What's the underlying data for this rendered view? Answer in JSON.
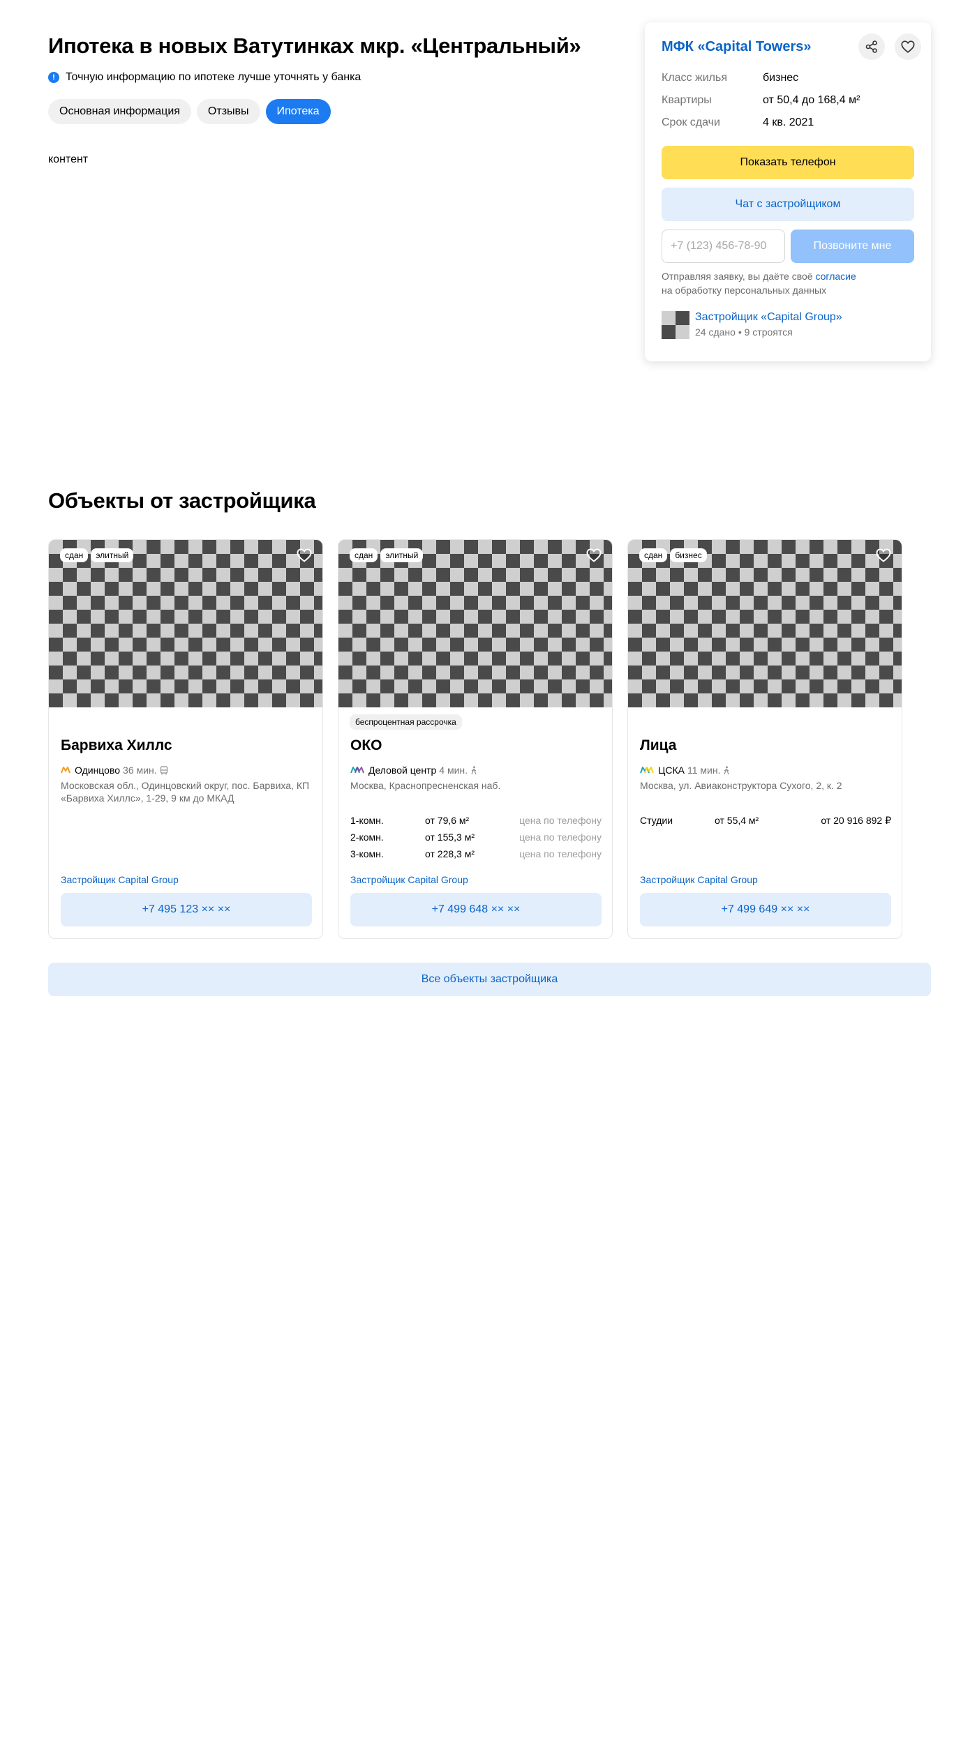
{
  "page": {
    "title": "Ипотека в новых Ватутинках мкр. «Центральный»",
    "notice": "Точную информацию по ипотеке лучше уточнять у банка",
    "notice_icon": "info-icon",
    "tabs": [
      {
        "label": "Основная информация",
        "active": false
      },
      {
        "label": "Отзывы",
        "active": false
      },
      {
        "label": "Ипотека",
        "active": true
      }
    ],
    "content_text": "контент"
  },
  "side": {
    "title": "МФК «Capital Towers»",
    "share_icon": "share-icon",
    "favorite_icon": "heart-icon",
    "params": [
      {
        "key": "Класс жилья",
        "value": "бизнес"
      },
      {
        "key": "Квартиры",
        "value": "от 50,4 до 168,4 м²"
      },
      {
        "key": "Срок сдачи",
        "value": "4 кв. 2021"
      }
    ],
    "show_phone_label": "Показать телефон",
    "chat_label": "Чат с застройщиком",
    "phone_placeholder": "+7 (123) 456-78-90",
    "call_label": "Позвоните мне",
    "consent_text_1": "Отправляя заявку, вы даёте своё",
    "consent_link": "согласие",
    "consent_text_2": "на обработку персональных данных",
    "developer_name": "Застройщик «Capital Group»",
    "developer_stats": "24 сдано • 9 строятся"
  },
  "section": {
    "title": "Объекты от застройщика",
    "cards": [
      {
        "badges": [
          "сдан",
          "элитный"
        ],
        "promo": "",
        "name": "Барвиха Хиллс",
        "metro_color": "#f49d1b",
        "station": "Одинцово",
        "time": "36 мин.",
        "transport_icon": "bus-icon",
        "address": "Московская обл., Одинцовский округ, пос. Барвиха, КП «Барвиха Хиллс», 1-29, 9 км до МКАД",
        "rooms": [],
        "developer": "Застройщик Capital Group",
        "phone": "+7 495 123 ×× ××"
      },
      {
        "badges": [
          "сдан",
          "элитный"
        ],
        "promo": "беспроцентная рассрочка",
        "name": "ОКО",
        "metro_color": "#1ea6b5",
        "station": "Деловой центр",
        "time": "4 мин.",
        "transport_icon": "walk-icon",
        "address": "Москва, Краснопресненская наб.",
        "rooms": [
          {
            "type": "1-комн.",
            "area": "от 79,6 м²",
            "price": "цена по телефону"
          },
          {
            "type": "2-комн.",
            "area": "от 155,3 м²",
            "price": "цена по телефону"
          },
          {
            "type": "3-комн.",
            "area": "от 228,3 м²",
            "price": "цена по телефону"
          }
        ],
        "developer": "Застройщик Capital Group",
        "phone": "+7 499 648 ×× ××"
      },
      {
        "badges": [
          "сдан",
          "бизнес"
        ],
        "promo": "",
        "name": "Лица",
        "metro_color": "#f5d31a",
        "station": "ЦСКА",
        "time": "11 мин.",
        "transport_icon": "walk-icon",
        "address": "Москва, ул. Авиаконструктора Сухого, 2, к. 2",
        "rooms": [
          {
            "type": "Студии",
            "area": "от 55,4 м²",
            "price": "от 20 916 892 ₽"
          }
        ],
        "developer": "Застройщик Capital Group",
        "phone": "+7 499 649 ×× ××"
      }
    ],
    "all_objects_label": "Все объекты застройщика"
  }
}
